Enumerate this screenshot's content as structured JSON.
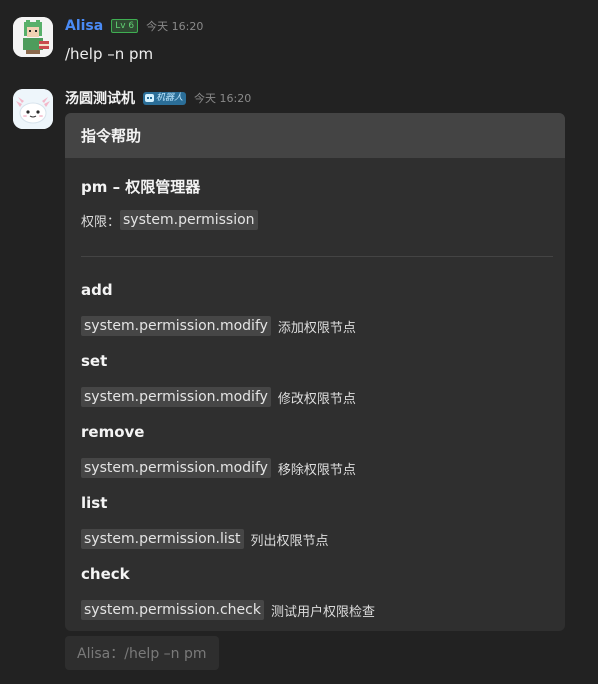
{
  "messages": [
    {
      "username": "Alisa",
      "level_badge": "Lv 6",
      "time": "今天 16:20",
      "text": "/help –n pm"
    },
    {
      "username": "汤圆测试机",
      "bot_badge": "机器人",
      "time": "今天 16:20"
    }
  ],
  "card": {
    "header": "指令帮助",
    "command_title": "pm – 权限管理器",
    "permission_label": "权限：",
    "permission_value": "system.permission",
    "subcommands": [
      {
        "name": "add",
        "permission": "system.permission.modify",
        "desc": "添加权限节点"
      },
      {
        "name": "set",
        "permission": "system.permission.modify",
        "desc": "修改权限节点"
      },
      {
        "name": "remove",
        "permission": "system.permission.modify",
        "desc": "移除权限节点"
      },
      {
        "name": "list",
        "permission": "system.permission.list",
        "desc": "列出权限节点"
      },
      {
        "name": "check",
        "permission": "system.permission.check",
        "desc": "测试用户权限检查"
      }
    ]
  },
  "reply": {
    "text": "Alisa：/help –n pm"
  },
  "colors": {
    "background": "#222222",
    "username_accent": "#4a8bf5",
    "card_header": "#444444",
    "card_body": "#2f2f2f",
    "level_badge": "#62d274",
    "bot_badge": "#2b6e98"
  },
  "icons": {
    "user_avatar": "avatar-icon",
    "bot_avatar": "avatar-icon",
    "bot_badge_icon": "robot-icon"
  }
}
